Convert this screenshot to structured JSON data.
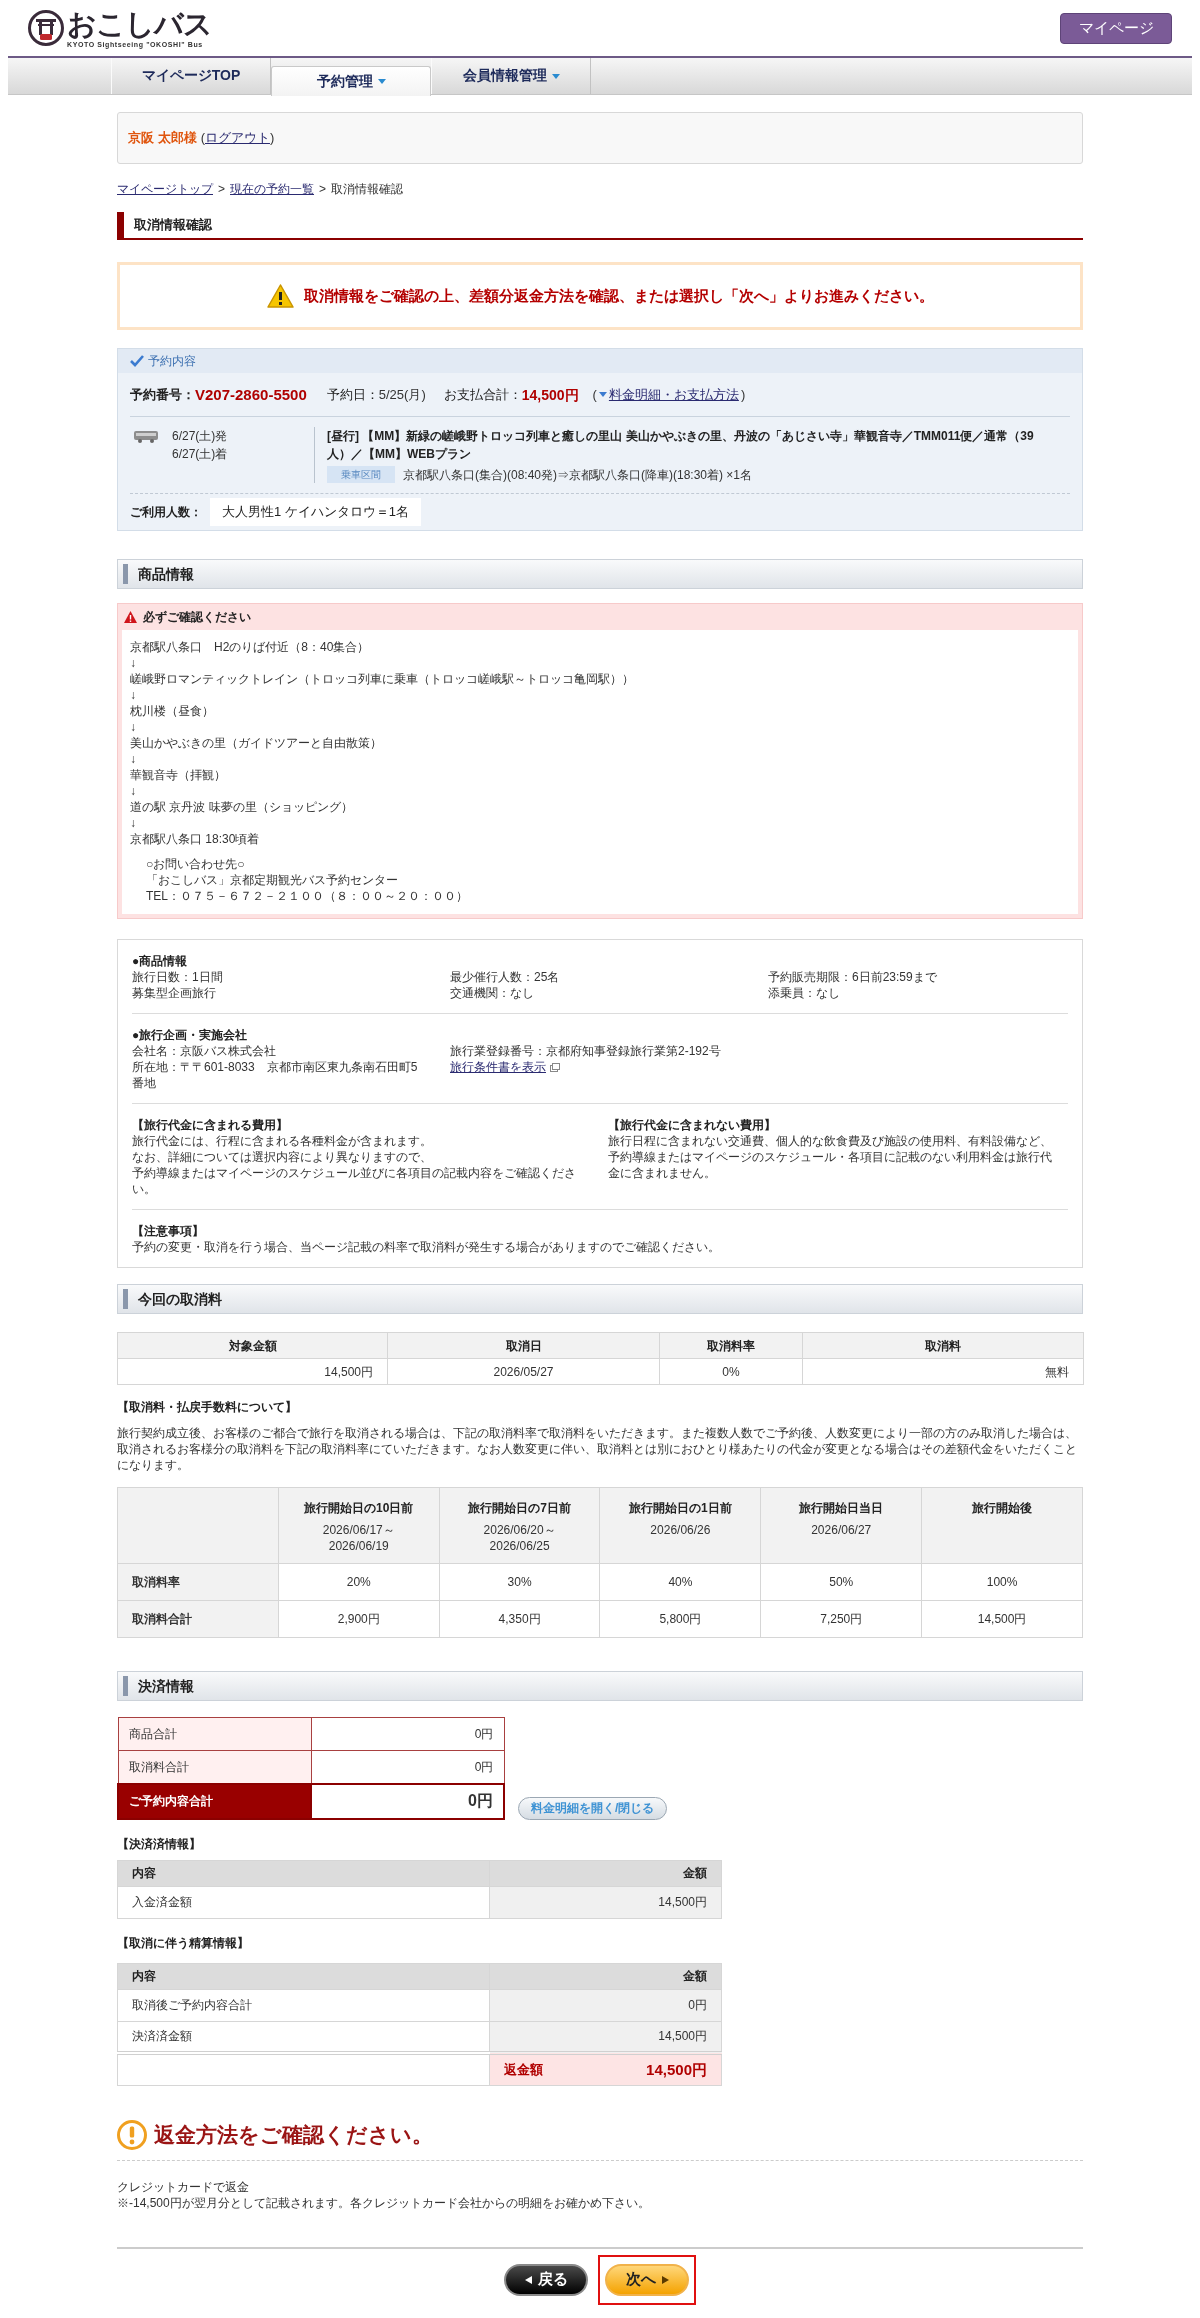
{
  "header": {
    "logo_title": "おこしバス",
    "logo_subtitle": "KYOTO Sightseeing \"OKOSHI\" Bus",
    "mypage_button": "マイページ"
  },
  "nav_tabs": [
    {
      "label": "マイページTOP",
      "selected": false,
      "dropdown": false
    },
    {
      "label": "予約管理",
      "selected": true,
      "dropdown": true
    },
    {
      "label": "会員情報管理",
      "selected": false,
      "dropdown": true
    }
  ],
  "user": {
    "name": "京阪 太郎様",
    "paren_open": "(",
    "logout": "ログアウト",
    "paren_close": ")"
  },
  "breadcrumb": [
    {
      "kind": "link",
      "label": "マイページトップ"
    },
    {
      "kind": "separator",
      "label": ">"
    },
    {
      "kind": "link",
      "label": "現在の予約一覧"
    },
    {
      "kind": "separator",
      "label": ">"
    },
    {
      "kind": "current",
      "label": "取消情報確認"
    }
  ],
  "page_title": "取消情報確認",
  "notice": "取消情報をご確認の上、差額分返金方法を確認、または選択し「次へ」よりお進みください。",
  "reservation": {
    "heading": "予約内容",
    "number_label": "予約番号：",
    "number": "V207-2860-5500",
    "date_label": "予約日：",
    "date": "5/25(月)",
    "total_label": "お支払合計：",
    "total": "14,500円",
    "link_open": "(",
    "link": "料金明細・お支払方法",
    "link_close": ")",
    "trip": {
      "depart": "6/27(土)発",
      "arrive": "6/27(土)着",
      "title": "[昼行] 【MM】新緑の嵯峨野トロッコ列車と癒しの里山 美山かやぶきの里、丹波の「あじさい寺」華観音寺／TMM011便／通常（39人）／【MM】WEBプラン",
      "section_tag": "乗車区間",
      "section": "京都駅八条口(集合)(08:40発)⇒京都駅八条口(降車)(18:30着) ×1名"
    },
    "passengers_label": "ご利用人数：",
    "passengers": "大人男性1 ケイハンタロウ＝1名"
  },
  "product": {
    "heading": "商品情報",
    "notice_heading": "必ずご確認ください",
    "itinerary": [
      "京都駅八条口　H2のりば付近（8：40集合）",
      "↓",
      "嵯峨野ロマンティックトレイン（トロッコ列車に乗車（トロッコ嵯峨駅～トロッコ亀岡駅））",
      "↓",
      "枕川楼（昼食）",
      "↓",
      "美山かやぶきの里（ガイドツアーと自由散策）",
      "↓",
      "華観音寺（拝観）",
      "↓",
      "道の駅 京丹波 味夢の里（ショッピング）",
      "↓",
      "京都駅八条口 18:30頃着"
    ],
    "contact": [
      "○お問い合わせ先○",
      "「おこしバス」京都定期観光バス予約センター",
      "TEL：０７５－６７２－２１００（８：００～２０：００）"
    ],
    "info_heading": "●商品情報",
    "info": [
      "旅行日数：1日間",
      "最少催行人数：25名",
      "予約販売期限：6日前23:59まで",
      "募集型企画旅行",
      "交通機関：なし",
      "添乗員：なし"
    ],
    "company_heading": "●旅行企画・実施会社",
    "company_name": "会社名：京阪バス株式会社",
    "registration": "旅行業登録番号：京都府知事登録旅行業第2-192号",
    "address": "所在地：〒〒601-8033　京都市南区東九条南石田町5番地",
    "terms_link": "旅行条件書を表示",
    "included_heading": "【旅行代金に含まれる費用】",
    "included": [
      "旅行代金には、行程に含まれる各種料金が含まれます。",
      "なお、詳細については選択内容により異なりますので、",
      "予約導線またはマイページのスケジュール並びに各項目の記載内容をご確認ください。"
    ],
    "excluded_heading": "【旅行代金に含まれない費用】",
    "excluded": "旅行日程に含まれない交通費、個人的な飲食費及び施設の使用料、有料設備など、予約導線またはマイページのスケジュール・各項目に記載のない利用料金は旅行代金に含まれません。",
    "notes_heading": "【注意事項】",
    "notes": "予約の変更・取消を行う場合、当ページ記載の料率で取消料が発生する場合がありますのでご確認ください。"
  },
  "cancel": {
    "heading": "今回の取消料",
    "columns": [
      "対象金額",
      "取消日",
      "取消料率",
      "取消料"
    ],
    "row": [
      "14,500円",
      "2026/05/27",
      "0%",
      "無料"
    ],
    "policy_heading": "【取消料・払戻手数料について】",
    "policy": "旅行契約成立後、お客様のご都合で旅行を取消される場合は、下記の取消料率で取消料をいただきます。また複数人数でご予約後、人数変更により一部の方のみ取消した場合は、取消されるお客様分の取消料を下記の取消料率にていただきます。なお人数変更に伴い、取消料とは別におひとり様あたりの代金が変更となる場合はその差額代金をいただくことになります。",
    "fee_columns": [
      {
        "title": "旅行開始日の10日前",
        "dates": [
          "2026/06/17～",
          "2026/06/19"
        ]
      },
      {
        "title": "旅行開始日の7日前",
        "dates": [
          "2026/06/20～",
          "2026/06/25"
        ]
      },
      {
        "title": "旅行開始日の1日前",
        "dates": [
          "2026/06/26"
        ]
      },
      {
        "title": "旅行開始日当日",
        "dates": [
          "2026/06/27"
        ]
      },
      {
        "title": "旅行開始後"
      }
    ],
    "fee_rows": [
      {
        "label": "取消料率",
        "values": [
          "20%",
          "30%",
          "40%",
          "50%",
          "100%"
        ]
      },
      {
        "label": "取消料合計",
        "values": [
          "2,900円",
          "4,350円",
          "5,800円",
          "7,250円",
          "14,500円"
        ]
      }
    ]
  },
  "payment": {
    "heading": "決済情報",
    "summary": [
      {
        "kind": "subtotal",
        "label": "商品合計",
        "value": "0円"
      },
      {
        "kind": "subtotal",
        "label": "取消料合計",
        "value": "0円"
      },
      {
        "kind": "total",
        "label": "ご予約内容合計",
        "value": "0円"
      }
    ],
    "toggle_button": "料金明細を開く/閉じる",
    "settled_heading": "【決済済情報】",
    "settled_columns": [
      "内容",
      "金額"
    ],
    "settled_rows": [
      {
        "label": "入金済金額",
        "value": "14,500円"
      }
    ],
    "settlement_heading": "【取消に伴う精算情報】",
    "settlement_columns": [
      "内容",
      "金額"
    ],
    "settlement_rows": [
      {
        "label": "取消後ご予約内容合計",
        "value": "0円"
      },
      {
        "label": "決済済金額",
        "value": "14,500円"
      }
    ],
    "refund_label": "返金額",
    "refund_value": "14,500円"
  },
  "refund_method": {
    "heading": "返金方法をご確認ください。",
    "lines": [
      "クレジットカードで返金",
      "※-14,500円が翌月分として記載されます。各クレジットカード会社からの明細をお確かめ下さい。"
    ]
  },
  "buttons": [
    {
      "kind": "back",
      "label": "戻る",
      "highlighted": false
    },
    {
      "kind": "next",
      "label": "次へ",
      "highlighted": true
    }
  ]
}
